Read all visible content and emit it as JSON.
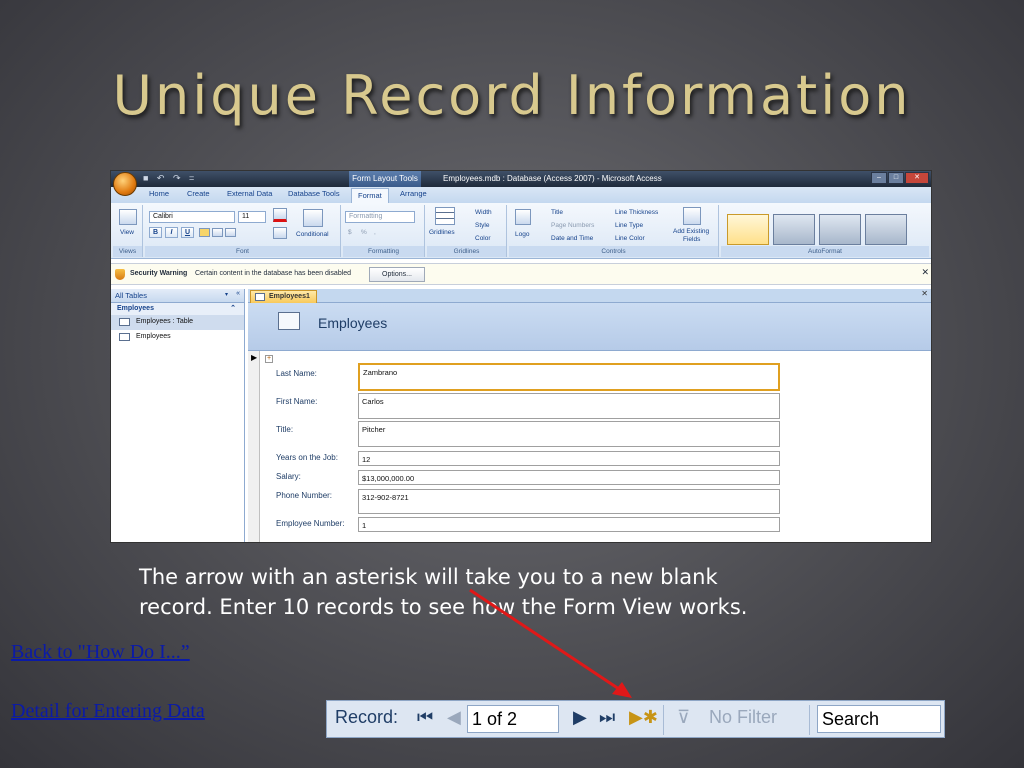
{
  "slide": {
    "title": "Unique Record Information",
    "caption_line1": "The arrow with an asterisk will take you to a new blank",
    "caption_line2": "record.  Enter 10 records to see how the Form View works.",
    "links": [
      "Back to \"How Do I...”",
      "Detail for Entering Data"
    ],
    "arrow_color": "#e01818"
  },
  "window": {
    "qat": "■ ↶ ↷ =",
    "context_tab": "Form Layout Tools",
    "title": "Employees.mdb : Database (Access 2007) - Microsoft Access",
    "controls": [
      "–",
      "□",
      "✕"
    ]
  },
  "ribbon": {
    "tabs": [
      "Home",
      "Create",
      "External Data",
      "Database Tools",
      "Format",
      "Arrange"
    ],
    "active_tab": "Format",
    "groups": {
      "views": {
        "label": "Views",
        "view_button": "View"
      },
      "font": {
        "label": "Font",
        "font_name": "Calibri",
        "font_size": "11",
        "bold": "B",
        "italic": "I",
        "underline": "U",
        "conditional": "Conditional"
      },
      "formatting": {
        "label": "Formatting",
        "format_box": "Formatting",
        "currency": "$",
        "percent": "%",
        "comma": ","
      },
      "gridlines": {
        "label": "Gridlines",
        "gridlines": "Gridlines",
        "width": "Width",
        "style": "Style",
        "color": "Color"
      },
      "controls": {
        "label": "Controls",
        "logo": "Logo",
        "title": "Title",
        "page_numbers": "Page Numbers",
        "date_time": "Date and Time",
        "line_thickness": "Line Thickness",
        "line_type": "Line Type",
        "line_color": "Line Color",
        "add_fields_1": "Add Existing",
        "add_fields_2": "Fields"
      },
      "autoformat": {
        "label": "AutoFormat"
      }
    }
  },
  "security": {
    "heading": "Security Warning",
    "message": "Certain content in the database has been disabled",
    "options": "Options..."
  },
  "nav": {
    "header": "All Tables",
    "group": "Employees",
    "items": [
      "Employees : Table",
      "Employees"
    ]
  },
  "document": {
    "tab": "Employees1",
    "form_title": "Employees",
    "fields": [
      {
        "label": "Last Name:",
        "value": "Zambrano"
      },
      {
        "label": "First Name:",
        "value": "Carlos"
      },
      {
        "label": "Title:",
        "value": "Pitcher"
      },
      {
        "label": "Years on the Job:",
        "value": "12"
      },
      {
        "label": "Salary:",
        "value": "$13,000,000.00"
      },
      {
        "label": "Phone Number:",
        "value": "312-902-8721"
      },
      {
        "label": "Employee Number:",
        "value": "1"
      }
    ]
  },
  "record_nav": {
    "label": "Record:",
    "position": "1 of 2",
    "filter": "No Filter",
    "search": "Search"
  }
}
